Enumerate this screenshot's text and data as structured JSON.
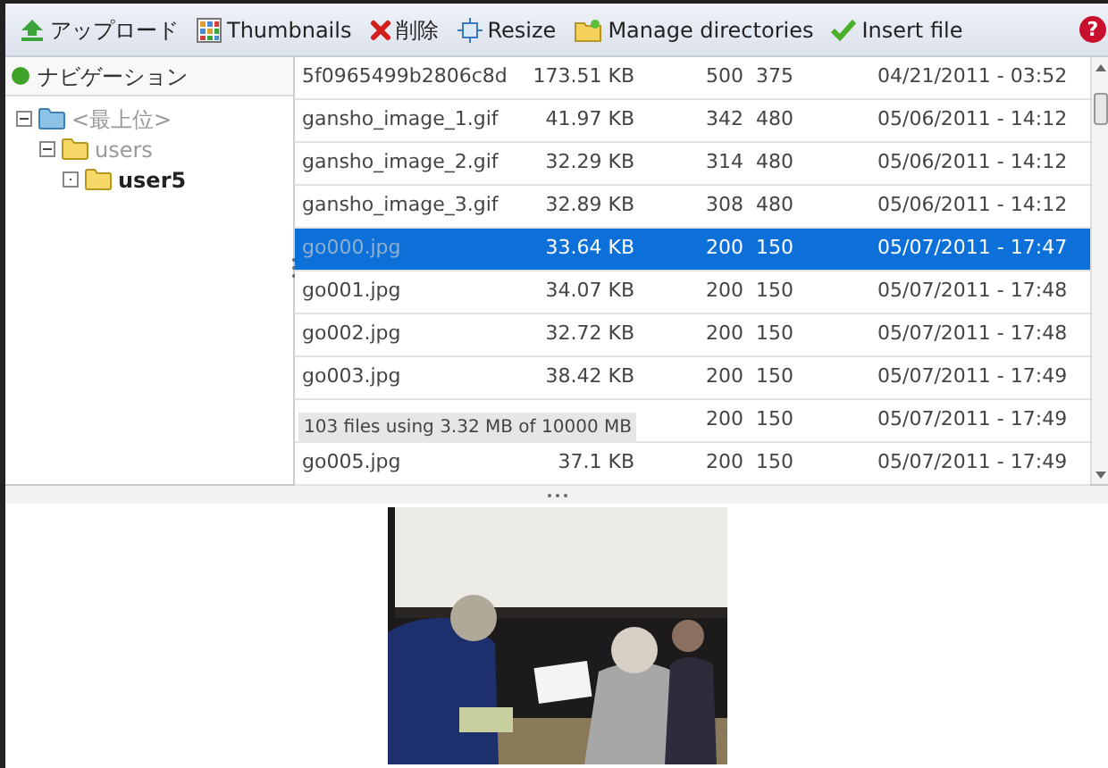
{
  "toolbar": [
    {
      "kind": "upload",
      "label": "アップロード"
    },
    {
      "kind": "thumbnails",
      "label": "Thumbnails"
    },
    {
      "kind": "delete",
      "label": "削除"
    },
    {
      "kind": "resize",
      "label": "Resize"
    },
    {
      "kind": "directories",
      "label": "Manage directories"
    },
    {
      "kind": "insert",
      "label": "Insert file"
    }
  ],
  "help": "?",
  "navigation": {
    "title": "ナビゲーション",
    "tree": [
      {
        "label": "<最上位>",
        "expanded": true,
        "selected": false,
        "children": [
          {
            "label": "users",
            "expanded": true,
            "selected": false,
            "children": [
              {
                "label": "user5",
                "expanded": false,
                "selected": true
              }
            ]
          }
        ]
      }
    ]
  },
  "files": [
    {
      "name": "5f0965499b2806c8d",
      "size": "173.51 KB",
      "dimensions": "500  375",
      "date": "04/21/2011 - 03:52",
      "selected": false
    },
    {
      "name": "gansho_image_1.gif",
      "size": "41.97 KB",
      "dimensions": "342  480",
      "date": "05/06/2011 - 14:12",
      "selected": false
    },
    {
      "name": "gansho_image_2.gif",
      "size": "32.29 KB",
      "dimensions": "314  480",
      "date": "05/06/2011 - 14:12",
      "selected": false
    },
    {
      "name": "gansho_image_3.gif",
      "size": "32.89 KB",
      "dimensions": "308  480",
      "date": "05/06/2011 - 14:12",
      "selected": false
    },
    {
      "name": "go000.jpg",
      "size": "33.64 KB",
      "dimensions": "200  150",
      "date": "05/07/2011 - 17:47",
      "selected": true
    },
    {
      "name": "go001.jpg",
      "size": "34.07 KB",
      "dimensions": "200  150",
      "date": "05/07/2011 - 17:48",
      "selected": false
    },
    {
      "name": "go002.jpg",
      "size": "32.72 KB",
      "dimensions": "200  150",
      "date": "05/07/2011 - 17:48",
      "selected": false
    },
    {
      "name": "go003.jpg",
      "size": "38.42 KB",
      "dimensions": "200  150",
      "date": "05/07/2011 - 17:49",
      "selected": false
    },
    {
      "dimensions": "200  150",
      "date": "05/07/2011 - 17:49",
      "selected": false
    },
    {
      "name": "go005.jpg",
      "size": "37.1 KB",
      "dimensions": "200  150",
      "date": "05/07/2011 - 17:49",
      "selected": false
    }
  ],
  "status": "103 files using 3.32 MB of 10000 MB"
}
